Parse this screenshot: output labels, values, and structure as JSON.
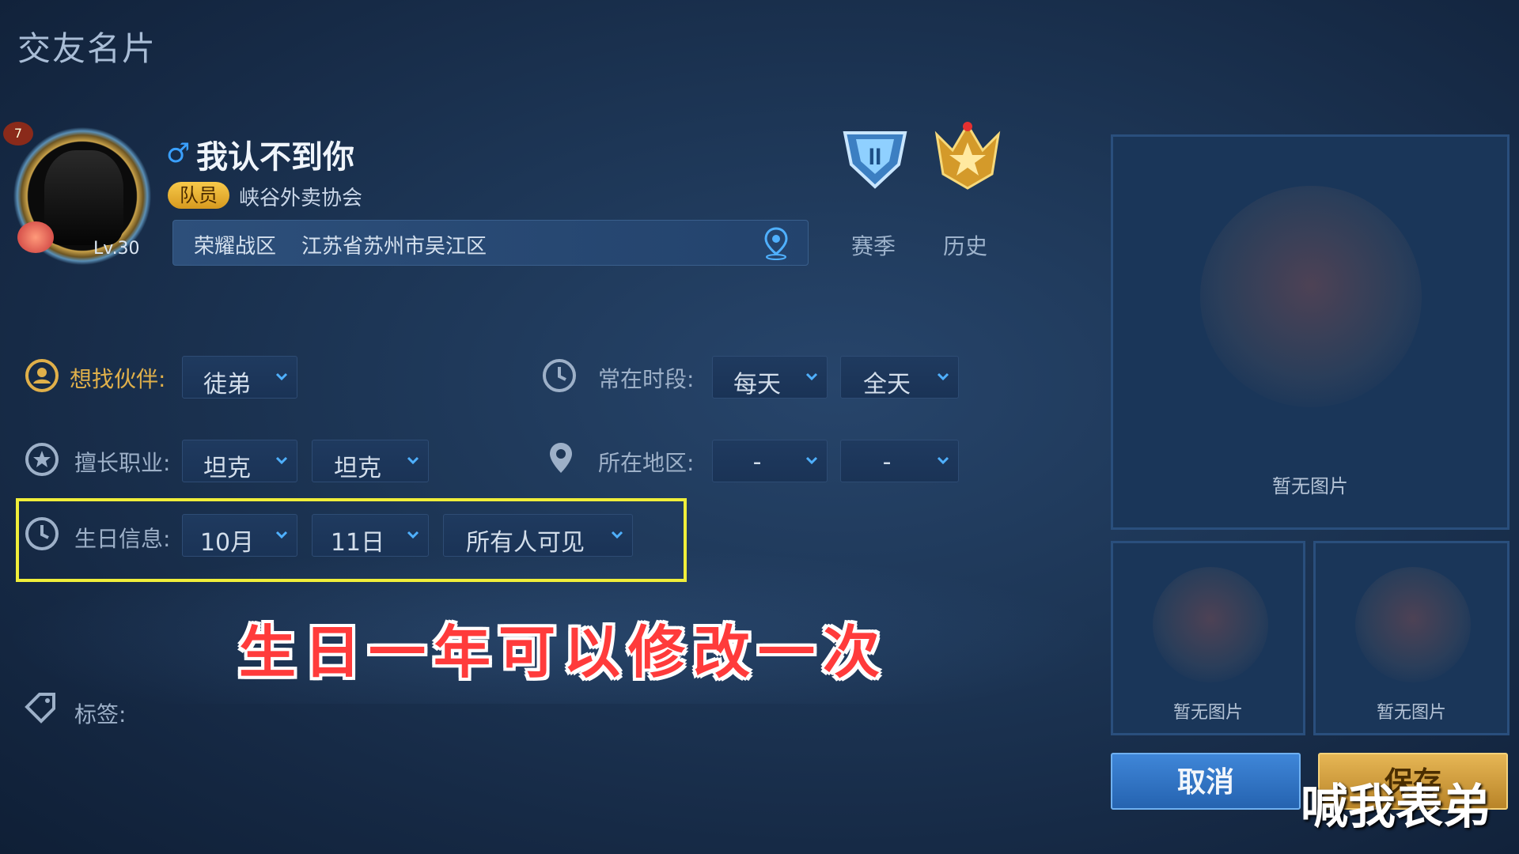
{
  "page": {
    "title": "交友名片"
  },
  "profile": {
    "badge_number": "7",
    "level": "Lv.30",
    "gender_icon": "male-icon",
    "name": "我认不到你",
    "role_badge": "队员",
    "guild": "峡谷外卖协会",
    "zone_label": "荣耀战区",
    "zone_value": "江苏省苏州市吴江区"
  },
  "ranks": {
    "season_label": "赛季",
    "history_label": "历史"
  },
  "form": {
    "partner": {
      "label": "想找伙伴:",
      "value": "徒弟"
    },
    "online": {
      "label": "常在时段:",
      "day": "每天",
      "time": "全天"
    },
    "job": {
      "label": "擅长职业:",
      "first": "坦克",
      "second": "坦克"
    },
    "region": {
      "label": "所在地区:",
      "first": "-",
      "second": "-"
    },
    "birthday": {
      "label": "生日信息:",
      "month": "10月",
      "day": "11日",
      "visibility": "所有人可见"
    },
    "tags": {
      "label": "标签:"
    }
  },
  "caption": "生日一年可以修改一次",
  "photos": {
    "placeholder_main": "暂无图片",
    "placeholder_1": "暂无图片",
    "placeholder_2": "暂无图片"
  },
  "buttons": {
    "cancel": "取消",
    "save": "保存"
  },
  "watermark": "喊我表弟",
  "colors": {
    "highlight": "#f0ee3a",
    "caption": "#ff3b3b",
    "cancel": "#2f73c4",
    "save": "#d4a342"
  }
}
